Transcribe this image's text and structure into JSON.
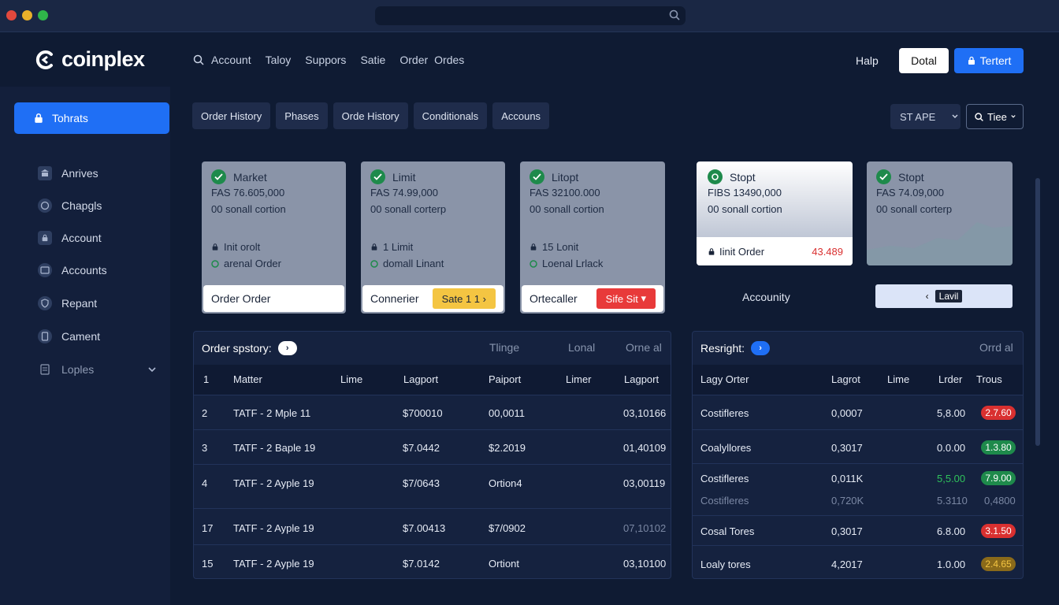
{
  "colors": {
    "accent": "#1f6ff5",
    "success": "#1e8a4b",
    "danger": "#d93030",
    "warning": "#f4c542"
  },
  "header": {
    "logo": "coinplex",
    "nav": [
      "Account",
      "Taloy",
      "Suppors",
      "Satie",
      "Order",
      "Ordes"
    ],
    "help": "Halp",
    "btn_dotal": "Dotal",
    "btn_tertert": "Tertert"
  },
  "sidebar": {
    "active": "Tohrats",
    "items": [
      "Anrives",
      "Chapgls",
      "Account",
      "Accounts",
      "Repant",
      "Cament",
      "Loples"
    ]
  },
  "tabs": [
    "Order History",
    "Phases",
    "Orde History",
    "Conditionals",
    "Accouns"
  ],
  "filters": {
    "stape": "ST APE",
    "tiee": "Tiee"
  },
  "cards": [
    {
      "title": "Market",
      "price": "FAS 76.605,000",
      "desc": "00 sonall cortion",
      "lock": "Init orolt",
      "type": "arenal Order",
      "foot": "Order Order"
    },
    {
      "title": "Limit",
      "price": "FAS 74.99,000",
      "desc": "00 sonall corterp",
      "lock": "1 Limit",
      "type": "domall Linant",
      "foot": "Connerier",
      "btn": "Sate 1 1"
    },
    {
      "title": "Litopt",
      "price": "FAS 32100.000",
      "desc": "00 sonall cortion",
      "lock": "15 Lonit",
      "type": "Loenal Lrlack",
      "foot": "Ortecaller",
      "btn": "Sife Sit"
    }
  ],
  "stop_cards": [
    {
      "title": "Stopt",
      "price": "FIBS 13490,000",
      "desc": "00 sonall cortion",
      "limit": "Iinit Order",
      "limit_value": "43.489"
    },
    {
      "title": "Stopt",
      "price": "FAS 74.09,000",
      "desc": "00 sonall corterp"
    }
  ],
  "accountly": "Accounity",
  "lavil": "Lavil",
  "orders": {
    "title": "Order spstory:",
    "cols_top": [
      "Tlinge",
      "Lonal",
      "Orne al"
    ],
    "cols": [
      "Matter",
      "Lime",
      "Lagport",
      "Paiport",
      "Limer",
      "Lagport"
    ],
    "header_index": "1",
    "rows": [
      {
        "n": "2",
        "name": "TATF - 2 Mple 11",
        "a": "$700010",
        "b": "00,0011",
        "c": "03,10166"
      },
      {
        "n": "3",
        "name": "TATF - 2 Baple 19",
        "a": "$7.0442",
        "b": "$2.2019",
        "c": "01,40109"
      },
      {
        "n": "4",
        "name": "TATF - 2 Ayple 19",
        "a": "$7/0643",
        "b": "Ortion4",
        "c": "03,00119"
      },
      {
        "n": "17",
        "name": "TATF - 2 Ayple 19",
        "a": "$7.00413",
        "b": "$7/0902",
        "c": "07,10102"
      },
      {
        "n": "15",
        "name": "TATF - 2 Ayple 19",
        "a": "$7.0142",
        "b": "Ortiont",
        "c": "03,10100"
      }
    ]
  },
  "resright": {
    "title": "Resright:",
    "col_top": "Orrd al",
    "cols": [
      "Lagy Orter",
      "Lagrot",
      "Lime",
      "Lrder",
      "Trous"
    ],
    "rows": [
      {
        "name": "Costifleres",
        "a": "0,0007",
        "b": "5,8.00",
        "badge": "2.7.60",
        "color": "#d93030"
      },
      {
        "name": "Coalyllores",
        "a": "0,3017",
        "b": "0.0.00",
        "badge": "1.3.80",
        "color": "#1e8a4b"
      },
      {
        "name": "Costifleres",
        "a": "0,011K",
        "b": "5,5.00",
        "badge": "7.9.00",
        "color": "#1e8a4b",
        "sub_name": "Costifleres",
        "sub_a": "0,720K",
        "sub_b": "5.3110",
        "sub_c": "0,4800"
      },
      {
        "name": "Cosal Tores",
        "a": "0,3017",
        "b": "6.8.00",
        "badge": "3.1.50",
        "color": "#d93030"
      },
      {
        "name": "Loaly tores",
        "a": "4,2017",
        "b": "1.0.00",
        "badge": "2.4.65",
        "color": "#8a6a1a"
      }
    ]
  }
}
